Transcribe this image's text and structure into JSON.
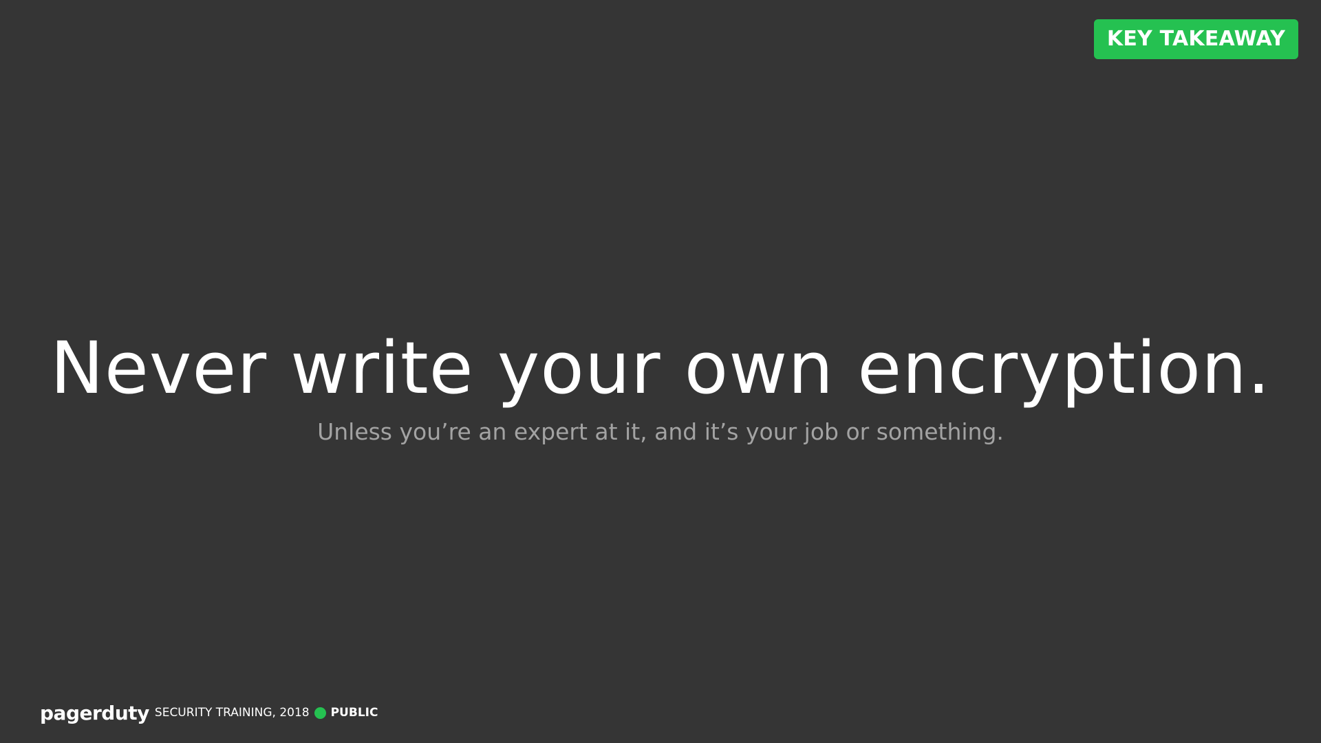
{
  "badge": {
    "label": "KEY TAKEAWAY",
    "color": "#25c151"
  },
  "slide": {
    "headline": "Never write your own encryption.",
    "subline": "Unless you’re an expert at it, and it’s your job or something.",
    "background": "#353535"
  },
  "footer": {
    "logo_text": "pagerduty",
    "training_text": "SECURITY TRAINING, 2018",
    "dot_color": "#25c151",
    "classification": "PUBLIC"
  }
}
